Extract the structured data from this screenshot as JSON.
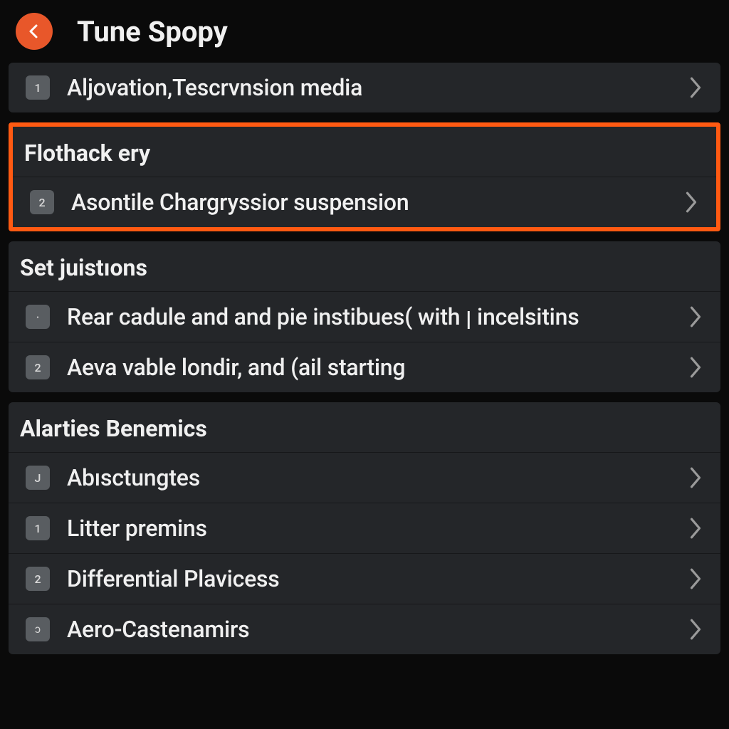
{
  "header": {
    "title": "Tune Spopy"
  },
  "top_panel": {
    "item": {
      "badge": "1",
      "label": "Aljovation,Tescrvnsion media"
    }
  },
  "highlighted": {
    "section_title": "Flothack ery",
    "item": {
      "badge": "2",
      "label": "Asontile Chargryssior suspension"
    }
  },
  "section_set": {
    "title": "Set juistıons",
    "items": [
      {
        "badge": "·",
        "label": "Rear cadule and and pie instibues( with ן incelsitins"
      },
      {
        "badge": "2",
        "label": "Aeva vable londir, and (ail starting"
      }
    ]
  },
  "section_alarties": {
    "title": "Alarties Benemics",
    "items": [
      {
        "badge": "J",
        "label": "Abısctungtes"
      },
      {
        "badge": "1",
        "label": "Litter premins"
      },
      {
        "badge": "2",
        "label": "Differential Plavicess"
      },
      {
        "badge": "ɔ",
        "label": "Aero-Castenamirs"
      }
    ]
  },
  "accent_color": "#e8572a",
  "highlight_color": "#ff5a12"
}
